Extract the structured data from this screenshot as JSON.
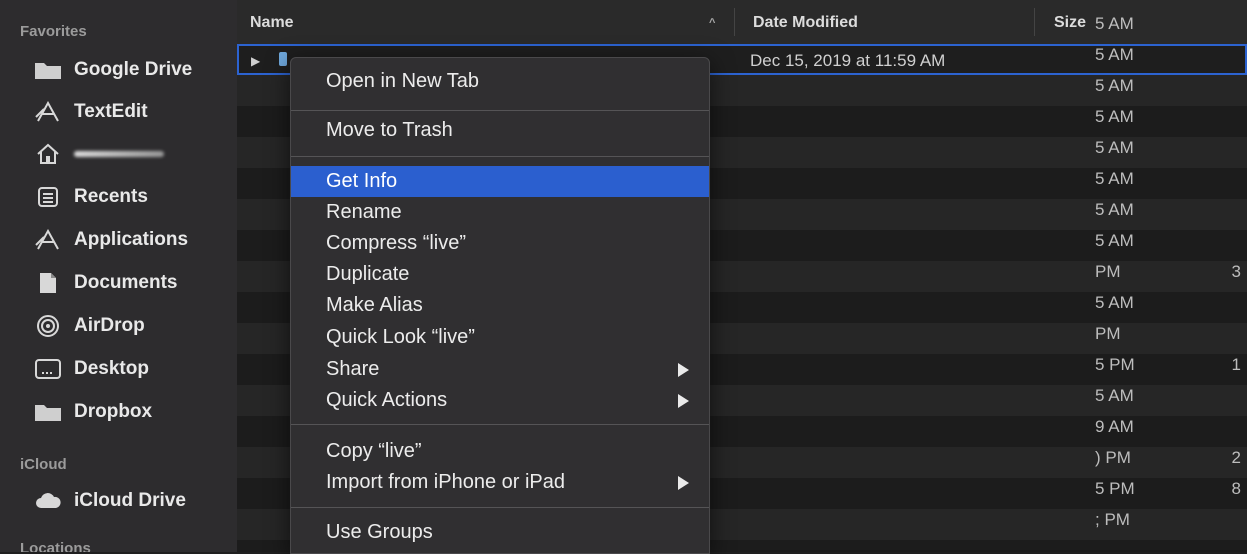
{
  "sidebar": {
    "favorites_title": "Favorites",
    "items": [
      {
        "label": "Google Drive",
        "icon": "folder-icon"
      },
      {
        "label": "TextEdit",
        "icon": "textedit-icon"
      },
      {
        "label": "",
        "icon": "home-icon"
      },
      {
        "label": "Recents",
        "icon": "recents-icon"
      },
      {
        "label": "Applications",
        "icon": "applications-icon"
      },
      {
        "label": "Documents",
        "icon": "documents-icon"
      },
      {
        "label": "AirDrop",
        "icon": "airdrop-icon"
      },
      {
        "label": "Desktop",
        "icon": "desktop-icon"
      },
      {
        "label": "Dropbox",
        "icon": "folder-icon"
      }
    ],
    "icloud_title": "iCloud",
    "icloud_items": [
      {
        "label": "iCloud Drive",
        "icon": "cloud-icon"
      }
    ],
    "locations_title": "Locations"
  },
  "header": {
    "name": "Name",
    "date_modified": "Date Modified",
    "size": "Size"
  },
  "selected_row": {
    "date": "Dec 15, 2019 at 11:59 AM"
  },
  "time_column": [
    "5 AM",
    "5 AM",
    "5 AM",
    "5 AM",
    "5 AM",
    "5 AM",
    "5 AM",
    "5 AM",
    "PM",
    "5 AM",
    "PM",
    "5 PM",
    "5 AM",
    "9 AM",
    ") PM",
    "5 PM",
    "; PM"
  ],
  "size_column_partial": [
    "3",
    "1",
    "2",
    "8"
  ],
  "context_menu": {
    "items": [
      {
        "label": "Open in New Tab",
        "submenu": false
      },
      {
        "label": "Move to Trash",
        "submenu": false
      },
      {
        "label": "Get Info",
        "submenu": false,
        "highlighted": true
      },
      {
        "label": "Rename",
        "submenu": false
      },
      {
        "label": "Compress “live”",
        "submenu": false
      },
      {
        "label": "Duplicate",
        "submenu": false
      },
      {
        "label": "Make Alias",
        "submenu": false
      },
      {
        "label": "Quick Look “live”",
        "submenu": false
      },
      {
        "label": "Share",
        "submenu": true
      },
      {
        "label": "Quick Actions",
        "submenu": true
      },
      {
        "label": "Copy “live”",
        "submenu": false
      },
      {
        "label": "Import from iPhone or iPad",
        "submenu": true
      },
      {
        "label": "Use Groups",
        "submenu": false
      }
    ]
  },
  "colors": {
    "highlight": "#2b5fcf",
    "selection_outline": "#2c63d1"
  }
}
